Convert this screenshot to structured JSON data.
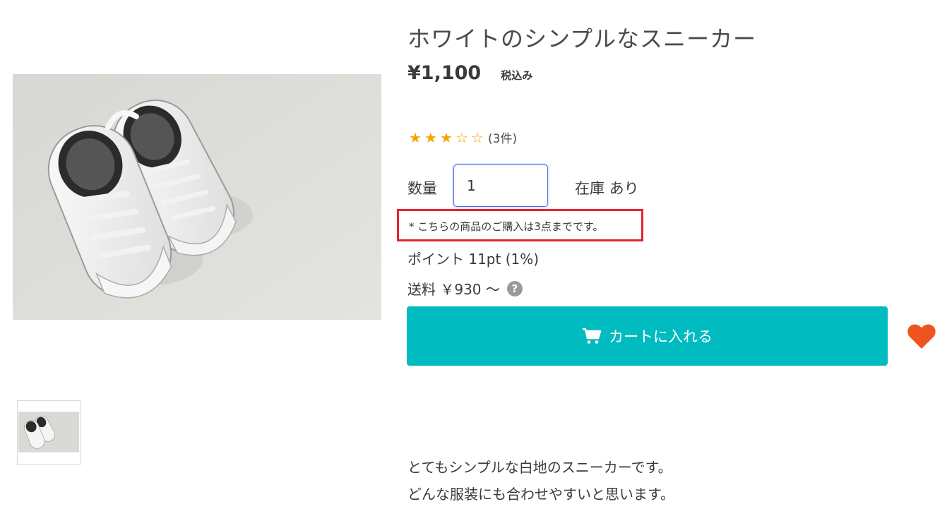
{
  "product": {
    "title": "ホワイトのシンプルなスニーカー",
    "price": "¥1,100",
    "tax_label": "税込み",
    "rating_stars": 3,
    "rating_max": 5,
    "review_count": "(3件)",
    "main_image_alt": "ホワイトのシンプルなスニーカー",
    "thumbnail_alt": "ホワイトのシンプルなスニーカー"
  },
  "quantity": {
    "label": "数量",
    "value": "1"
  },
  "stock": {
    "text": "在庫 あり"
  },
  "purchase_limit": {
    "text": "* こちらの商品のご購入は3点までです。"
  },
  "points": {
    "text": "ポイント 11pt (1%)"
  },
  "shipping": {
    "text": "送料 ￥930 〜",
    "help_icon": "question-circle-icon"
  },
  "cart_button": {
    "label": "カートに入れる",
    "icon": "cart-icon"
  },
  "favorite": {
    "icon": "heart-icon"
  },
  "description": {
    "lines": [
      "とてもシンプルな白地のスニーカーです。",
      "どんな服装にも合わせやすいと思います。"
    ]
  },
  "colors": {
    "accent": "#00bcc1",
    "heart": "#f0541e",
    "star": "#f4a500",
    "highlight_border": "#e8202a",
    "input_focus": "#4a6be8"
  }
}
